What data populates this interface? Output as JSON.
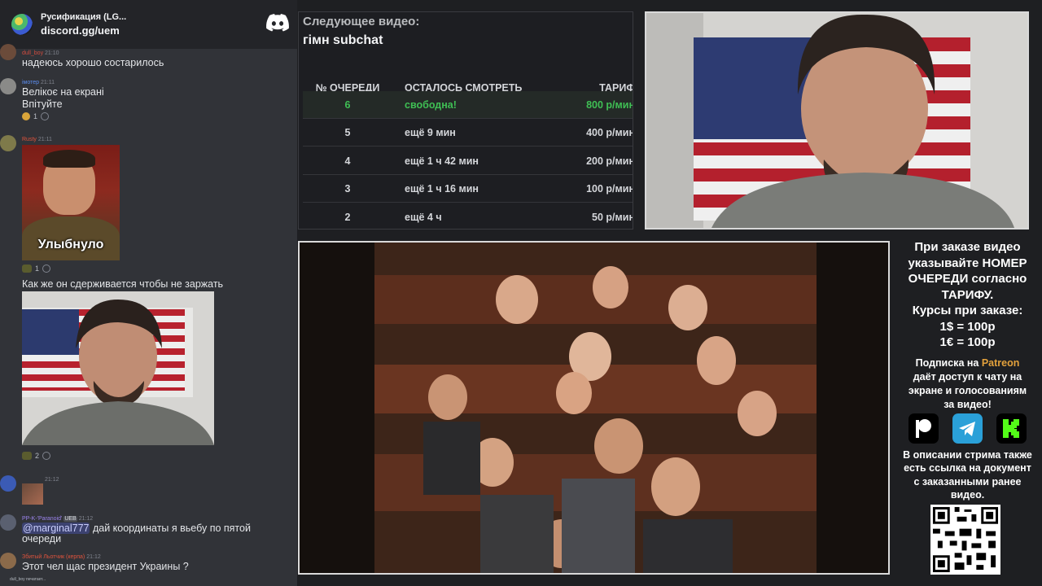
{
  "discord": {
    "server_name": "Русификация (LG...",
    "invite": "discord.gg/uem",
    "logo_icon": "discord-logo-icon"
  },
  "chat": {
    "messages": [
      {
        "user": "dull_boy",
        "time": "21:10",
        "text": "надеюсь хорошо состарилось",
        "user_color": "#d14b3f"
      },
      {
        "user": "імотер",
        "time": "21:11",
        "text1": "Велікоє на екрані",
        "text2": "Впітуйте",
        "reaction_count": "1",
        "user_color": "#5b8def"
      },
      {
        "user": "Rusty",
        "time": "21:11",
        "image_caption": "Улыбнуло",
        "reaction_count": "1",
        "user_color": "#e0533c"
      },
      {
        "text": "Как же он сдерживается чтобы не заржать",
        "reaction_count": "2"
      },
      {
        "time": "21:12"
      },
      {
        "user": "PP-K-'Paranoid'",
        "badge": "UEB",
        "time": "21:12",
        "mention": "@marginal777",
        "text_after": " дай координаты я вьебу по пятой",
        "text2": "очереди",
        "user_color": "#9b84ec"
      },
      {
        "user": "Збитый Льотчик (керпа)",
        "time": "21:12",
        "text": "Этот чел щас президент Украины ?",
        "user_color": "#e0533c"
      }
    ],
    "typing": "dull_boy печатает..."
  },
  "queue": {
    "next_label": "Следующее видео:",
    "next_title": "гімн subchat",
    "headers": {
      "position": "№ ОЧЕРЕДИ",
      "remaining": "ОСТАЛОСЬ СМОТРЕТЬ",
      "tariff": "ТАРИФ"
    },
    "rows": [
      {
        "position": "6",
        "remaining": "свободна!",
        "tariff": "800 р/мин"
      },
      {
        "position": "5",
        "remaining": "ещё 9 мин",
        "tariff": "400 р/мин"
      },
      {
        "position": "4",
        "remaining": "ещё 1 ч 42 мин",
        "tariff": "200 р/мин"
      },
      {
        "position": "3",
        "remaining": "ещё 1 ч 16 мин",
        "tariff": "100 р/мин"
      },
      {
        "position": "2",
        "remaining": "ещё 4 ч",
        "tariff": "50 р/мин"
      }
    ],
    "highlight_color": "#3fbf54"
  },
  "info": {
    "main_lines": [
      "При заказе видео",
      "указывайте НОМЕР",
      "ОЧЕРЕДИ согласно",
      "ТАРИФУ.",
      "Курсы при заказе:",
      "1$ = 100р",
      "1€ = 100р"
    ],
    "sub_prefix": "Подписка на ",
    "patreon": "Patreon",
    "sub_lines": [
      "даёт доступ к чату на",
      "экране и голосованиям",
      "за видео!"
    ],
    "desc_lines": [
      "В описании стрима также",
      "есть ссылка на документ",
      "с заказанными ранее",
      "видео."
    ],
    "socials": [
      "patreon-icon",
      "telegram-icon",
      "kick-icon"
    ],
    "patreon_color": "#e3a13c"
  }
}
